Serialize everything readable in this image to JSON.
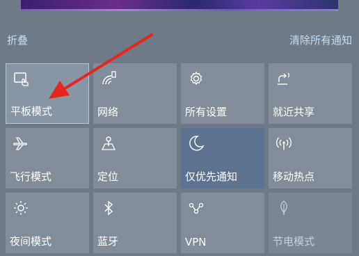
{
  "header": {
    "collapse_label": "折叠",
    "clear_label": "清除所有通知"
  },
  "tiles": [
    {
      "label": "平板模式",
      "icon": "tablet-mode-icon",
      "state": "selected"
    },
    {
      "label": "网络",
      "icon": "network-icon",
      "state": "normal"
    },
    {
      "label": "所有设置",
      "icon": "gear-icon",
      "state": "normal"
    },
    {
      "label": "就近共享",
      "icon": "nearby-share-icon",
      "state": "normal"
    },
    {
      "label": "飞行模式",
      "icon": "airplane-icon",
      "state": "normal"
    },
    {
      "label": "定位",
      "icon": "location-icon",
      "state": "normal"
    },
    {
      "label": "仅优先通知",
      "icon": "moon-icon",
      "state": "active"
    },
    {
      "label": "移动热点",
      "icon": "hotspot-icon",
      "state": "normal"
    },
    {
      "label": "夜间模式",
      "icon": "night-light-icon",
      "state": "normal"
    },
    {
      "label": "蓝牙",
      "icon": "bluetooth-icon",
      "state": "normal"
    },
    {
      "label": "VPN",
      "icon": "vpn-icon",
      "state": "normal"
    },
    {
      "label": "节电模式",
      "icon": "battery-saver-icon",
      "state": "disabled"
    }
  ],
  "colors": {
    "annotation_arrow": "#e8261e",
    "link_text": "#c9dcf0",
    "active_tile": "#5e7390"
  }
}
